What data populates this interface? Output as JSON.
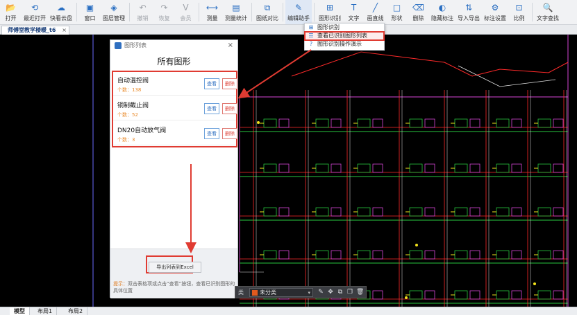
{
  "toolbar": {
    "groups": [
      [
        {
          "label": "打开",
          "icon": "folder-open-icon",
          "glyph": "📂"
        },
        {
          "label": "最近打开",
          "icon": "history-icon",
          "glyph": "⟲"
        },
        {
          "label": "快看云盘",
          "icon": "cloud-icon",
          "glyph": "☁"
        }
      ],
      [
        {
          "label": "窗口",
          "icon": "window-icon",
          "glyph": "▣"
        },
        {
          "label": "图层管理",
          "icon": "layers-icon",
          "glyph": "◈"
        }
      ],
      [
        {
          "label": "撤销",
          "icon": "undo-icon",
          "glyph": "↶",
          "disabled": true
        },
        {
          "label": "恢复",
          "icon": "redo-icon",
          "glyph": "↷",
          "disabled": true
        },
        {
          "label": "会员",
          "icon": "vip-icon",
          "glyph": "V",
          "disabled": true
        }
      ],
      [
        {
          "label": "测量",
          "icon": "measure-icon",
          "glyph": "⟷"
        },
        {
          "label": "测量统计",
          "icon": "measure-stats-icon",
          "glyph": "▤"
        }
      ],
      [
        {
          "label": "图纸对比",
          "icon": "compare-icon",
          "glyph": "⧉"
        }
      ],
      [
        {
          "label": "编辑助手",
          "icon": "edit-assistant-icon",
          "glyph": "✎",
          "active": true
        }
      ],
      [
        {
          "label": "图形识别",
          "icon": "shape-recognize-icon",
          "glyph": "⊞"
        },
        {
          "label": "文字",
          "icon": "text-icon",
          "glyph": "T"
        },
        {
          "label": "画直线",
          "icon": "line-icon",
          "glyph": "╱"
        },
        {
          "label": "形状",
          "icon": "shape-icon",
          "glyph": "□"
        },
        {
          "label": "删除",
          "icon": "delete-icon",
          "glyph": "⌫"
        },
        {
          "label": "隐藏标注",
          "icon": "hide-annotation-icon",
          "glyph": "◐"
        },
        {
          "label": "导入导出",
          "icon": "import-export-icon",
          "glyph": "⇅"
        },
        {
          "label": "标注设置",
          "icon": "annotation-settings-icon",
          "glyph": "⚙"
        },
        {
          "label": "比例",
          "icon": "scale-icon",
          "glyph": "⊡"
        }
      ],
      [
        {
          "label": "文字查找",
          "icon": "text-search-icon",
          "glyph": "🔍"
        }
      ]
    ]
  },
  "doc_tab": {
    "title": "师傅堂教学楼暖_t6",
    "close": "×"
  },
  "menu": {
    "items": [
      {
        "label": "图形识别",
        "icon": "shape-recognize-icon",
        "glyph": "⊞"
      },
      {
        "label": "查看已识别图形列表",
        "icon": "list-icon",
        "glyph": "☰",
        "highlight": true
      },
      {
        "label": "图形识别操作演示",
        "icon": "help-icon",
        "glyph": "?"
      }
    ]
  },
  "panel": {
    "header": "图形列表",
    "close": "×",
    "title": "所有图形",
    "items": [
      {
        "name": "自动温控阀",
        "count": "个数：138",
        "view": "查看",
        "delete": "删除"
      },
      {
        "name": "铜制截止阀",
        "count": "个数：52",
        "view": "查看",
        "delete": "删除"
      },
      {
        "name": "DN20自动放气阀",
        "count": "个数：3",
        "view": "查看",
        "delete": "删除"
      }
    ],
    "export_button": "导出列表到Excel",
    "hint_key": "提示：",
    "hint": "双击表格项或点击“查看”按钮，查看已识别图形的具体位置"
  },
  "floatbar": {
    "label": "类",
    "selected": "未分类",
    "caret": "▾"
  },
  "layout_tabs": [
    {
      "label": "模型",
      "active": true
    },
    {
      "label": "布局1",
      "active": false
    },
    {
      "label": "布局2",
      "active": false
    }
  ],
  "colors": {
    "highlight": "#e03b32",
    "accent": "#2f6fc0",
    "cad_red": "#ff2a2a",
    "cad_green": "#27c93f",
    "cad_yellow": "#f2e21c",
    "cad_magenta": "#d846d8",
    "cad_white": "#e6e6e6"
  }
}
